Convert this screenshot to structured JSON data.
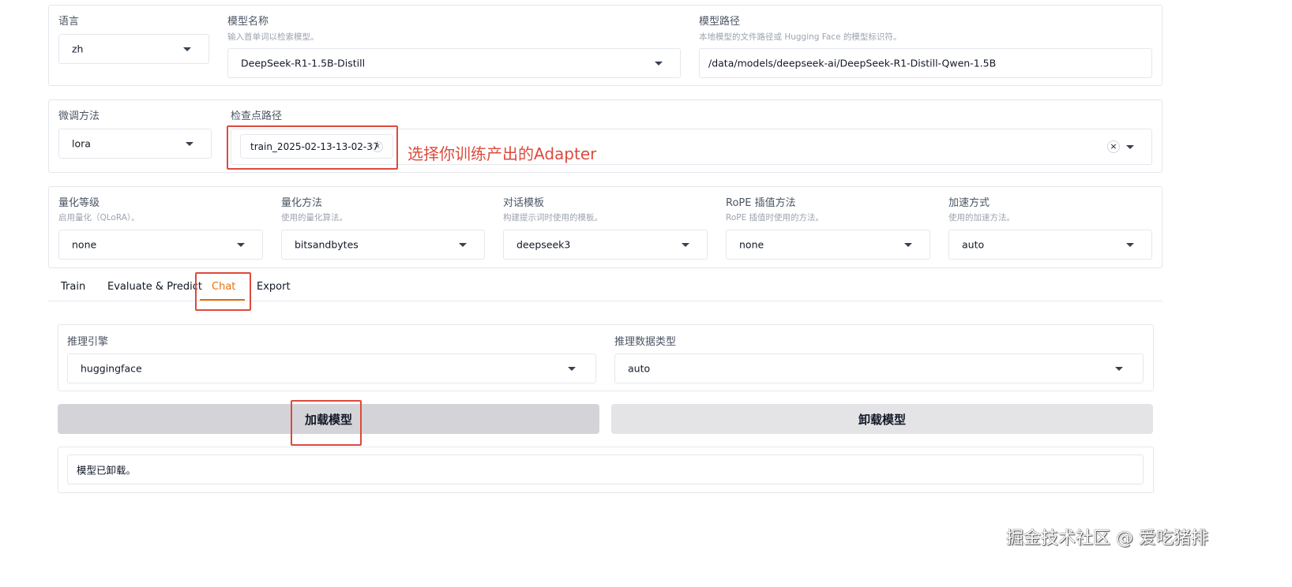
{
  "top": {
    "lang_label": "语言",
    "lang_value": "zh",
    "model_name_label": "模型名称",
    "model_name_info": "输入首单词以检索模型。",
    "model_name_value": "DeepSeek-R1-1.5B-Distill",
    "model_path_label": "模型路径",
    "model_path_info": "本地模型的文件路径或 Hugging Face 的模型标识符。",
    "model_path_value": "/data/models/deepseek-ai/DeepSeek-R1-Distill-Qwen-1.5B"
  },
  "finetune": {
    "method_label": "微调方法",
    "method_value": "lora",
    "checkpoint_label": "检查点路径",
    "checkpoint_chip": "train_2025-02-13-13-02-37",
    "chip_remove": "×",
    "clear_symbol": "×",
    "annotation": "选择你训练产出的Adapter"
  },
  "advanced": {
    "quant_bit_label": "量化等级",
    "quant_bit_info": "启用量化（QLoRA）。",
    "quant_bit_value": "none",
    "quant_method_label": "量化方法",
    "quant_method_info": "使用的量化算法。",
    "quant_method_value": "bitsandbytes",
    "template_label": "对话模板",
    "template_info": "构建提示词时使用的模板。",
    "template_value": "deepseek3",
    "rope_label": "RoPE 插值方法",
    "rope_info": "RoPE 插值时使用的方法。",
    "rope_value": "none",
    "booster_label": "加速方式",
    "booster_info": "使用的加速方法。",
    "booster_value": "auto"
  },
  "tabs": [
    "Train",
    "Evaluate & Predict",
    "Chat",
    "Export"
  ],
  "active_tab": "Chat",
  "chat": {
    "infer_backend_label": "推理引擎",
    "infer_backend_value": "huggingface",
    "infer_dtype_label": "推理数据类型",
    "infer_dtype_value": "auto",
    "load_button": "加载模型",
    "unload_button": "卸载模型",
    "status_text": "模型已卸载。"
  },
  "watermark": "掘金技术社区 @ 爱吃猪排",
  "colors": {
    "accent": "#e8710a",
    "annotation_red": "#dc4a3d",
    "button_primary_bg": "#d4d4d8",
    "button_secondary_bg": "#e4e4e7"
  }
}
